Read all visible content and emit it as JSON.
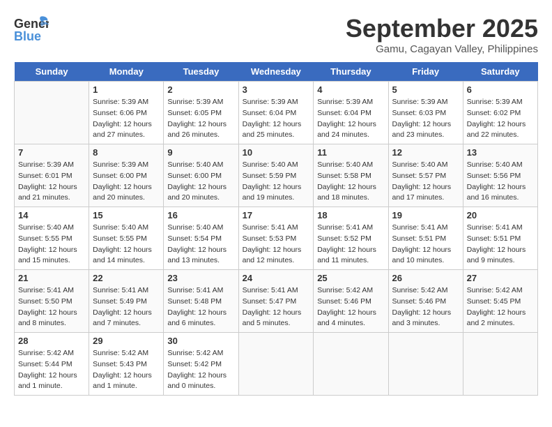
{
  "header": {
    "logo_general": "General",
    "logo_blue": "Blue",
    "month": "September 2025",
    "location": "Gamu, Cagayan Valley, Philippines"
  },
  "weekdays": [
    "Sunday",
    "Monday",
    "Tuesday",
    "Wednesday",
    "Thursday",
    "Friday",
    "Saturday"
  ],
  "weeks": [
    [
      {
        "num": "",
        "info": ""
      },
      {
        "num": "1",
        "info": "Sunrise: 5:39 AM\nSunset: 6:06 PM\nDaylight: 12 hours\nand 27 minutes."
      },
      {
        "num": "2",
        "info": "Sunrise: 5:39 AM\nSunset: 6:05 PM\nDaylight: 12 hours\nand 26 minutes."
      },
      {
        "num": "3",
        "info": "Sunrise: 5:39 AM\nSunset: 6:04 PM\nDaylight: 12 hours\nand 25 minutes."
      },
      {
        "num": "4",
        "info": "Sunrise: 5:39 AM\nSunset: 6:04 PM\nDaylight: 12 hours\nand 24 minutes."
      },
      {
        "num": "5",
        "info": "Sunrise: 5:39 AM\nSunset: 6:03 PM\nDaylight: 12 hours\nand 23 minutes."
      },
      {
        "num": "6",
        "info": "Sunrise: 5:39 AM\nSunset: 6:02 PM\nDaylight: 12 hours\nand 22 minutes."
      }
    ],
    [
      {
        "num": "7",
        "info": "Sunrise: 5:39 AM\nSunset: 6:01 PM\nDaylight: 12 hours\nand 21 minutes."
      },
      {
        "num": "8",
        "info": "Sunrise: 5:39 AM\nSunset: 6:00 PM\nDaylight: 12 hours\nand 20 minutes."
      },
      {
        "num": "9",
        "info": "Sunrise: 5:40 AM\nSunset: 6:00 PM\nDaylight: 12 hours\nand 20 minutes."
      },
      {
        "num": "10",
        "info": "Sunrise: 5:40 AM\nSunset: 5:59 PM\nDaylight: 12 hours\nand 19 minutes."
      },
      {
        "num": "11",
        "info": "Sunrise: 5:40 AM\nSunset: 5:58 PM\nDaylight: 12 hours\nand 18 minutes."
      },
      {
        "num": "12",
        "info": "Sunrise: 5:40 AM\nSunset: 5:57 PM\nDaylight: 12 hours\nand 17 minutes."
      },
      {
        "num": "13",
        "info": "Sunrise: 5:40 AM\nSunset: 5:56 PM\nDaylight: 12 hours\nand 16 minutes."
      }
    ],
    [
      {
        "num": "14",
        "info": "Sunrise: 5:40 AM\nSunset: 5:55 PM\nDaylight: 12 hours\nand 15 minutes."
      },
      {
        "num": "15",
        "info": "Sunrise: 5:40 AM\nSunset: 5:55 PM\nDaylight: 12 hours\nand 14 minutes."
      },
      {
        "num": "16",
        "info": "Sunrise: 5:40 AM\nSunset: 5:54 PM\nDaylight: 12 hours\nand 13 minutes."
      },
      {
        "num": "17",
        "info": "Sunrise: 5:41 AM\nSunset: 5:53 PM\nDaylight: 12 hours\nand 12 minutes."
      },
      {
        "num": "18",
        "info": "Sunrise: 5:41 AM\nSunset: 5:52 PM\nDaylight: 12 hours\nand 11 minutes."
      },
      {
        "num": "19",
        "info": "Sunrise: 5:41 AM\nSunset: 5:51 PM\nDaylight: 12 hours\nand 10 minutes."
      },
      {
        "num": "20",
        "info": "Sunrise: 5:41 AM\nSunset: 5:51 PM\nDaylight: 12 hours\nand 9 minutes."
      }
    ],
    [
      {
        "num": "21",
        "info": "Sunrise: 5:41 AM\nSunset: 5:50 PM\nDaylight: 12 hours\nand 8 minutes."
      },
      {
        "num": "22",
        "info": "Sunrise: 5:41 AM\nSunset: 5:49 PM\nDaylight: 12 hours\nand 7 minutes."
      },
      {
        "num": "23",
        "info": "Sunrise: 5:41 AM\nSunset: 5:48 PM\nDaylight: 12 hours\nand 6 minutes."
      },
      {
        "num": "24",
        "info": "Sunrise: 5:41 AM\nSunset: 5:47 PM\nDaylight: 12 hours\nand 5 minutes."
      },
      {
        "num": "25",
        "info": "Sunrise: 5:42 AM\nSunset: 5:46 PM\nDaylight: 12 hours\nand 4 minutes."
      },
      {
        "num": "26",
        "info": "Sunrise: 5:42 AM\nSunset: 5:46 PM\nDaylight: 12 hours\nand 3 minutes."
      },
      {
        "num": "27",
        "info": "Sunrise: 5:42 AM\nSunset: 5:45 PM\nDaylight: 12 hours\nand 2 minutes."
      }
    ],
    [
      {
        "num": "28",
        "info": "Sunrise: 5:42 AM\nSunset: 5:44 PM\nDaylight: 12 hours\nand 1 minute."
      },
      {
        "num": "29",
        "info": "Sunrise: 5:42 AM\nSunset: 5:43 PM\nDaylight: 12 hours\nand 1 minute."
      },
      {
        "num": "30",
        "info": "Sunrise: 5:42 AM\nSunset: 5:42 PM\nDaylight: 12 hours\nand 0 minutes."
      },
      {
        "num": "",
        "info": ""
      },
      {
        "num": "",
        "info": ""
      },
      {
        "num": "",
        "info": ""
      },
      {
        "num": "",
        "info": ""
      }
    ]
  ]
}
